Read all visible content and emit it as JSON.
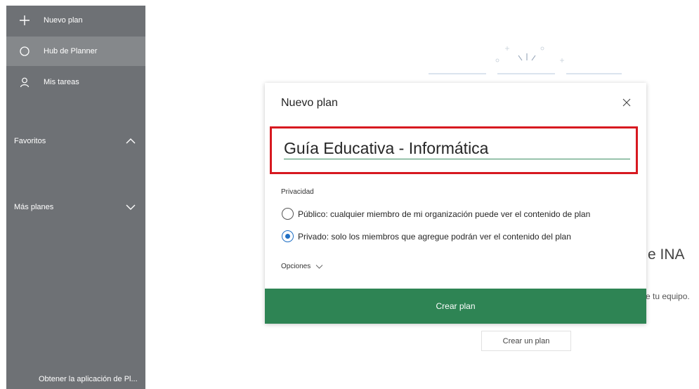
{
  "sidebar": {
    "items": [
      {
        "label": "Nuevo plan",
        "icon": "plus-icon"
      },
      {
        "label": "Hub de Planner",
        "icon": "circle-icon"
      },
      {
        "label": "Mis tareas",
        "icon": "person-icon"
      }
    ],
    "favorites_label": "Favoritos",
    "more_plans_label": "Más planes",
    "get_app_label": "Obtener la aplicación de Pl..."
  },
  "background": {
    "heading": "e INA",
    "subtext": "e tu equipo.",
    "create_button_label": "Crear un plan"
  },
  "dialog": {
    "title": "Nuevo plan",
    "plan_name_value": "Guía Educativa - Informática",
    "privacy_label": "Privacidad",
    "public_option": "Público: cualquier miembro de mi organización puede ver el contenido de plan",
    "private_option": "Privado: solo los miembros que agregue podrán ver el contenido del plan",
    "selected_privacy": "private",
    "options_label": "Opciones",
    "create_button_label": "Crear plan"
  },
  "colors": {
    "sidebar_bg": "#6e7175",
    "sidebar_active": "#85888b",
    "primary_green": "#2e8454",
    "highlight_red": "#d71920",
    "radio_blue": "#1f6fc5"
  }
}
